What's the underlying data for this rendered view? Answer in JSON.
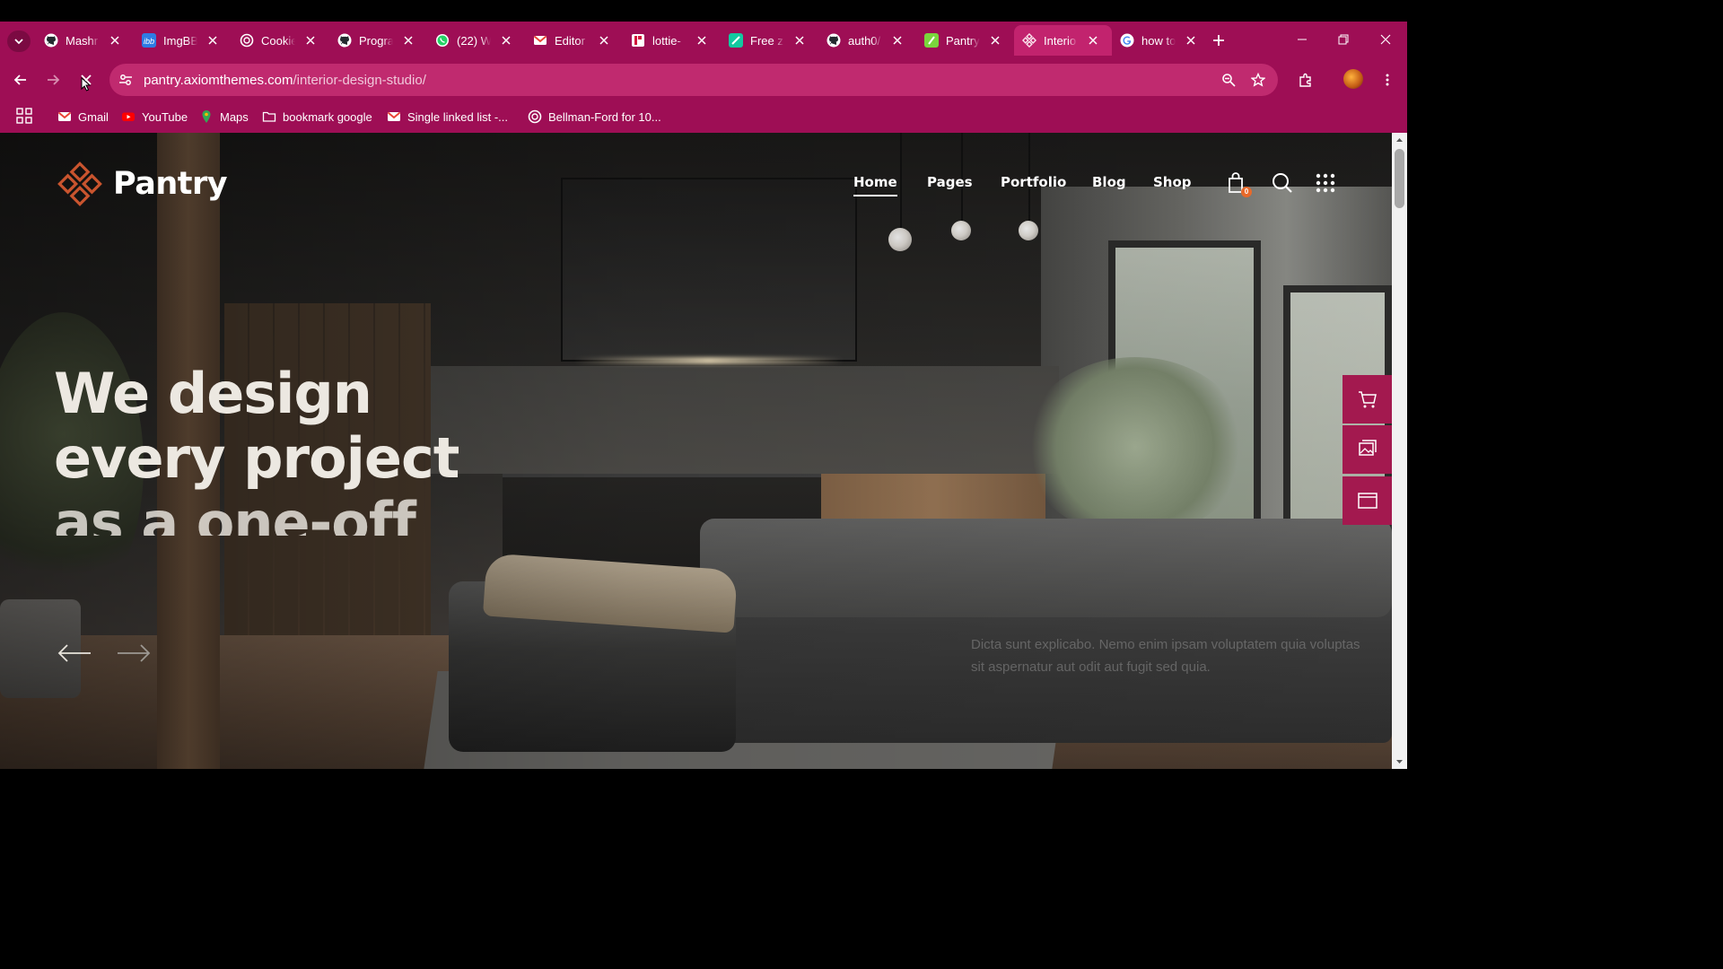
{
  "browser": {
    "tabs": [
      {
        "title": "Mashr",
        "icon": "github-icon",
        "active": false
      },
      {
        "title": "ImgBB",
        "icon": "imgbb-icon",
        "active": false
      },
      {
        "title": "Cookie",
        "icon": "openai-icon",
        "active": false
      },
      {
        "title": "Progra",
        "icon": "github-icon",
        "active": false
      },
      {
        "title": "(22) W",
        "icon": "whatsapp-icon",
        "active": false
      },
      {
        "title": "Editor",
        "icon": "gmail-icon",
        "active": false
      },
      {
        "title": "lottie-",
        "icon": "lottie-icon",
        "active": false
      },
      {
        "title": "Free z",
        "icon": "freeze-icon",
        "active": false
      },
      {
        "title": "auth0/",
        "icon": "github-icon",
        "active": false
      },
      {
        "title": "Pantry",
        "icon": "pantry-icon",
        "active": false
      },
      {
        "title": "Interio",
        "icon": "page-icon",
        "active": true
      },
      {
        "title": "how to",
        "icon": "google-icon",
        "active": false
      }
    ],
    "address": {
      "domain": "pantry.axiomthemes.com",
      "path": "/interior-design-studio/"
    },
    "bookmarks": [
      {
        "label": "Gmail",
        "icon": "gmail-icon"
      },
      {
        "label": "YouTube",
        "icon": "youtube-icon"
      },
      {
        "label": "Maps",
        "icon": "maps-icon"
      },
      {
        "label": "bookmark google",
        "icon": "folder-icon"
      },
      {
        "label": "Single linked list -...",
        "icon": "gmail-icon"
      },
      {
        "label": "Bellman-Ford for 10...",
        "icon": "openai-icon"
      }
    ],
    "colors": {
      "chrome": "#9e0e55",
      "active_tab": "#c2236e",
      "omnibox": "#c02a6f"
    }
  },
  "site": {
    "logo_text": "Pantry",
    "nav": [
      {
        "label": "Home",
        "active": true
      },
      {
        "label": "Pages",
        "active": false
      },
      {
        "label": "Portfolio",
        "active": false
      },
      {
        "label": "Blog",
        "active": false
      },
      {
        "label": "Shop",
        "active": false
      }
    ],
    "cart_count": "0",
    "headline": [
      "We design",
      "every project",
      "as a one-off"
    ],
    "blurb": "Dicta sunt explicabo. Nemo enim ipsam voluptatem quia voluptas sit aspernatur aut odit aut fugit sed quia.",
    "side_panel_icons": [
      "cart-icon",
      "gallery-icon",
      "window-icon"
    ],
    "colors": {
      "accent": "#a3194f",
      "badge": "#e8692a",
      "logo": "#c9542e"
    }
  }
}
